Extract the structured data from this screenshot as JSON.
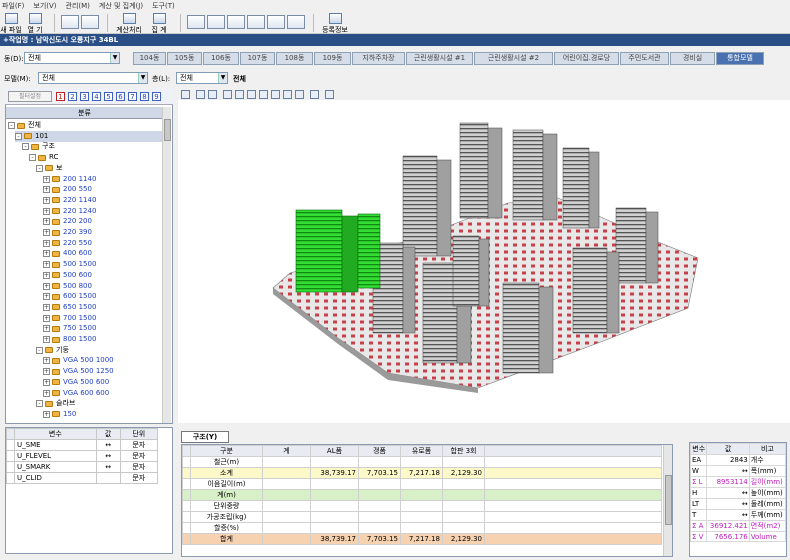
{
  "menu": [
    "파일(F)",
    "보기(V)",
    "관리(M)",
    "계산 및 집계(J)",
    "도구(T)"
  ],
  "toolbar": {
    "new_file": "새 파일",
    "open": "열 기",
    "calc": "계산처리",
    "agg": "집 계",
    "register": "등록정보"
  },
  "title": "+작업명 : 남악신도시 오룡지구 34BL",
  "building_label": "동(D):",
  "building_value": "전체",
  "tabs": [
    "104동",
    "105동",
    "106동",
    "107동",
    "108동",
    "109동",
    "지하주차장",
    "근린생활시설 #1",
    "근린생활시설 #2",
    "어린이집.경로당",
    "주민도서관",
    "경비실",
    "통합모델"
  ],
  "model_label": "모델(M):",
  "model_value": "전체",
  "floor_label": "층(L):",
  "floor_value": "전체",
  "floor_text": "전체",
  "filter_btn": "필터설정",
  "numbers": [
    "1",
    "2",
    "3",
    "4",
    "5",
    "6",
    "7",
    "8",
    "9"
  ],
  "tree_header": "분류",
  "tree": [
    {
      "label": "전체",
      "indent": 0,
      "exp": "-",
      "sel": false,
      "blue": false
    },
    {
      "label": "101",
      "indent": 1,
      "exp": "-",
      "sel": true,
      "blue": false
    },
    {
      "label": "구조",
      "indent": 2,
      "exp": "-",
      "sel": false,
      "blue": false
    },
    {
      "label": "RC",
      "indent": 3,
      "exp": "-",
      "sel": false,
      "blue": false
    },
    {
      "label": "보",
      "indent": 4,
      "exp": "-",
      "sel": false,
      "blue": false
    },
    {
      "label": "200 1140",
      "indent": 5,
      "exp": "+",
      "sel": false,
      "blue": true
    },
    {
      "label": "200 550",
      "indent": 5,
      "exp": "+",
      "sel": false,
      "blue": true
    },
    {
      "label": "220 1140",
      "indent": 5,
      "exp": "+",
      "sel": false,
      "blue": true
    },
    {
      "label": "220 1240",
      "indent": 5,
      "exp": "+",
      "sel": false,
      "blue": true
    },
    {
      "label": "220 200",
      "indent": 5,
      "exp": "+",
      "sel": false,
      "blue": true
    },
    {
      "label": "220 390",
      "indent": 5,
      "exp": "+",
      "sel": false,
      "blue": true
    },
    {
      "label": "220 550",
      "indent": 5,
      "exp": "+",
      "sel": false,
      "blue": true
    },
    {
      "label": "400 600",
      "indent": 5,
      "exp": "+",
      "sel": false,
      "blue": true
    },
    {
      "label": "500 1500",
      "indent": 5,
      "exp": "+",
      "sel": false,
      "blue": true
    },
    {
      "label": "500 600",
      "indent": 5,
      "exp": "+",
      "sel": false,
      "blue": true
    },
    {
      "label": "500 800",
      "indent": 5,
      "exp": "+",
      "sel": false,
      "blue": true
    },
    {
      "label": "600 1500",
      "indent": 5,
      "exp": "+",
      "sel": false,
      "blue": true
    },
    {
      "label": "650 1500",
      "indent": 5,
      "exp": "+",
      "sel": false,
      "blue": true
    },
    {
      "label": "700 1500",
      "indent": 5,
      "exp": "+",
      "sel": false,
      "blue": true
    },
    {
      "label": "750 1500",
      "indent": 5,
      "exp": "+",
      "sel": false,
      "blue": true
    },
    {
      "label": "800 1500",
      "indent": 5,
      "exp": "+",
      "sel": false,
      "blue": true
    },
    {
      "label": "기둥",
      "indent": 4,
      "exp": "-",
      "sel": false,
      "blue": false
    },
    {
      "label": "VGA 500 1000",
      "indent": 5,
      "exp": "+",
      "sel": false,
      "blue": true
    },
    {
      "label": "VGA 500 1250",
      "indent": 5,
      "exp": "+",
      "sel": false,
      "blue": true
    },
    {
      "label": "VGA 500 600",
      "indent": 5,
      "exp": "+",
      "sel": false,
      "blue": true
    },
    {
      "label": "VGA 600 600",
      "indent": 5,
      "exp": "+",
      "sel": false,
      "blue": true
    },
    {
      "label": "슬라브",
      "indent": 4,
      "exp": "-",
      "sel": false,
      "blue": false
    },
    {
      "label": "150",
      "indent": 5,
      "exp": "+",
      "sel": false,
      "blue": true
    }
  ],
  "var_table": {
    "headers": [
      "변수",
      "값",
      "단위"
    ],
    "rows": [
      [
        "U_SME",
        "↔",
        "문자"
      ],
      [
        "U_FLEVEL",
        "↔",
        "문자"
      ],
      [
        "U_SMARK",
        "↔",
        "문자"
      ],
      [
        "U_CLID",
        "",
        "문자"
      ]
    ]
  },
  "bottom_tab": "구조(Y)",
  "grid": {
    "headers": [
      "구분",
      "계",
      "AL폼",
      "갱폼",
      "유로폼",
      "합판 3회"
    ],
    "rows": [
      {
        "cells": [
          "철근(m)",
          "",
          "",
          "",
          "",
          ""
        ],
        "style": ""
      },
      {
        "cells": [
          "소계",
          "",
          "38,739.17",
          "7,703.15",
          "7,217.18",
          "2,129.30"
        ],
        "style": "yellow"
      },
      {
        "cells": [
          "이음길이(m)",
          "",
          "",
          "",
          "",
          ""
        ],
        "style": ""
      },
      {
        "cells": [
          "계(m)",
          "",
          "",
          "",
          "",
          ""
        ],
        "style": "green"
      },
      {
        "cells": [
          "단위중량",
          "",
          "",
          "",
          "",
          ""
        ],
        "style": ""
      },
      {
        "cells": [
          "가공조립(kg)",
          "",
          "",
          "",
          "",
          ""
        ],
        "style": ""
      },
      {
        "cells": [
          "할증(%)",
          "",
          "",
          "",
          "",
          ""
        ],
        "style": ""
      },
      {
        "cells": [
          "합계",
          "",
          "38,739.17",
          "7,703.15",
          "7,217.18",
          "2,129.30"
        ],
        "style": "orange"
      }
    ]
  },
  "right_table": {
    "headers": [
      "변수",
      "값",
      "비고"
    ],
    "rows": [
      {
        "cells": [
          "EA",
          "2843",
          "개수"
        ],
        "mag": false
      },
      {
        "cells": [
          "W",
          "↔",
          "폭(mm)"
        ],
        "mag": false
      },
      {
        "cells": [
          "Σ L",
          "8953114",
          "길이(mm)"
        ],
        "mag": true
      },
      {
        "cells": [
          "H",
          "↔",
          "높이(mm)"
        ],
        "mag": false
      },
      {
        "cells": [
          "LT",
          "↔",
          "둘레(mm)"
        ],
        "mag": false
      },
      {
        "cells": [
          "T",
          "↔",
          "두께(mm)"
        ],
        "mag": false
      },
      {
        "cells": [
          "Σ A",
          "36912.421",
          "면적(m2)"
        ],
        "mag": true
      },
      {
        "cells": [
          "Σ V",
          "7656.176",
          "Volume"
        ],
        "mag": true
      }
    ]
  },
  "colors": {
    "accent": "#2a4f87",
    "highlight_building": "#22cc22",
    "floor_tile": "#c8404a"
  }
}
